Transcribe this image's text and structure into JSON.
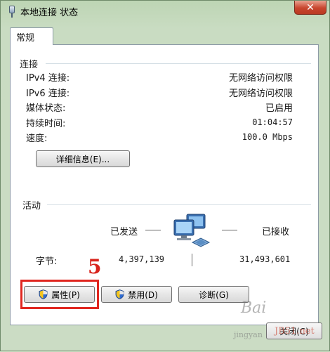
{
  "window": {
    "title": "本地连接 状态",
    "close_label": "✕"
  },
  "tab": {
    "label": "常规"
  },
  "connection": {
    "section_label": "连接",
    "rows": [
      {
        "label": "IPv4 连接:",
        "value": "无网络访问权限"
      },
      {
        "label": "IPv6 连接:",
        "value": "无网络访问权限"
      },
      {
        "label": "媒体状态:",
        "value": "已启用"
      },
      {
        "label": "持续时间:",
        "value": "01:04:57"
      },
      {
        "label": "速度:",
        "value": "100.0 Mbps"
      }
    ],
    "details_button": "详细信息(E)..."
  },
  "activity": {
    "section_label": "活动",
    "sent_label": "已发送",
    "received_label": "已接收",
    "bytes_label": "字节:",
    "bytes_sent": "4,397,139",
    "bytes_received": "31,493,601"
  },
  "buttons": {
    "properties": "属性(P)",
    "disable": "禁用(D)",
    "diagnose": "诊断(G)"
  },
  "annotation": {
    "step_number": "5"
  },
  "bottom_button": {
    "label": "关闭(C)"
  },
  "watermark": {
    "line1": "Bai",
    "line2": "jingyan",
    "line3": "JB51.net"
  },
  "colors": {
    "highlight": "#e0261f",
    "title_bar": "#c9dcc2",
    "close_button": "#c8452e"
  }
}
